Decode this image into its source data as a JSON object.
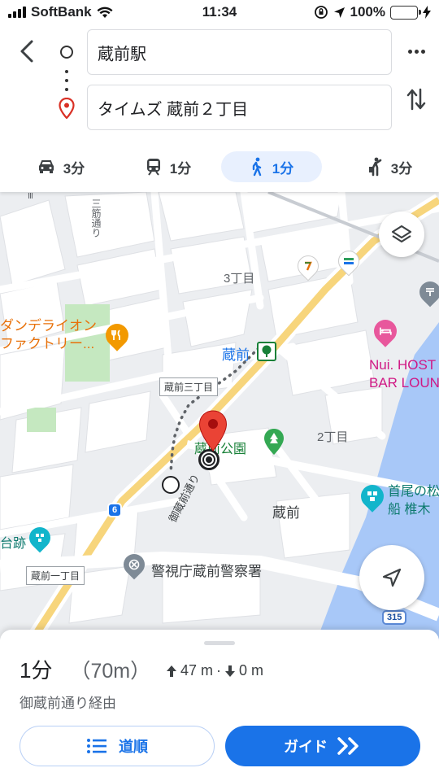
{
  "status_bar": {
    "carrier": "SoftBank",
    "time": "11:34",
    "battery": "100%"
  },
  "header": {
    "origin": "蔵前駅",
    "destination": "タイムズ 蔵前２丁目",
    "modes": [
      {
        "icon": "car-icon",
        "label": "3分"
      },
      {
        "icon": "train-icon",
        "label": "1分"
      },
      {
        "icon": "walk-icon",
        "label": "1分",
        "selected": true
      },
      {
        "icon": "rideshare-icon",
        "label": "3分"
      }
    ]
  },
  "map": {
    "labels": {
      "chome3": "3丁目",
      "chome2": "2丁目",
      "dandelion_line1": "ダンデライオン",
      "dandelion_line2": "ファクトリー...",
      "kuramae_station": "蔵前",
      "kuramae_sanchome_box": "蔵前三丁目",
      "kuramae_park": "蔵前公園",
      "nui_line1": "Nui. HOST",
      "nui_line2": "BAR LOUN",
      "shuto_line1": "首尾の松",
      "shuto_line2": "船 椎木",
      "kuramae_area": "蔵前",
      "police": "警視庁蔵前警察署",
      "kuramae_itchome_box": "蔵前一丁目",
      "ruins": "台跡",
      "road_name": "御蔵前通り",
      "vertical_road": "三筋通り",
      "route_6": "6",
      "route_315": "315"
    },
    "accent": "#1a73e8",
    "water": "#a8c8f8",
    "park": "#c5e8c0"
  },
  "sheet": {
    "duration": "1分",
    "distance": "（70m）",
    "elevation_up": "47 m",
    "elevation_sep": "·",
    "elevation_down": "0 m",
    "via": "御蔵前通り経由",
    "steps_button": "道順",
    "guide_button": "ガイド"
  }
}
